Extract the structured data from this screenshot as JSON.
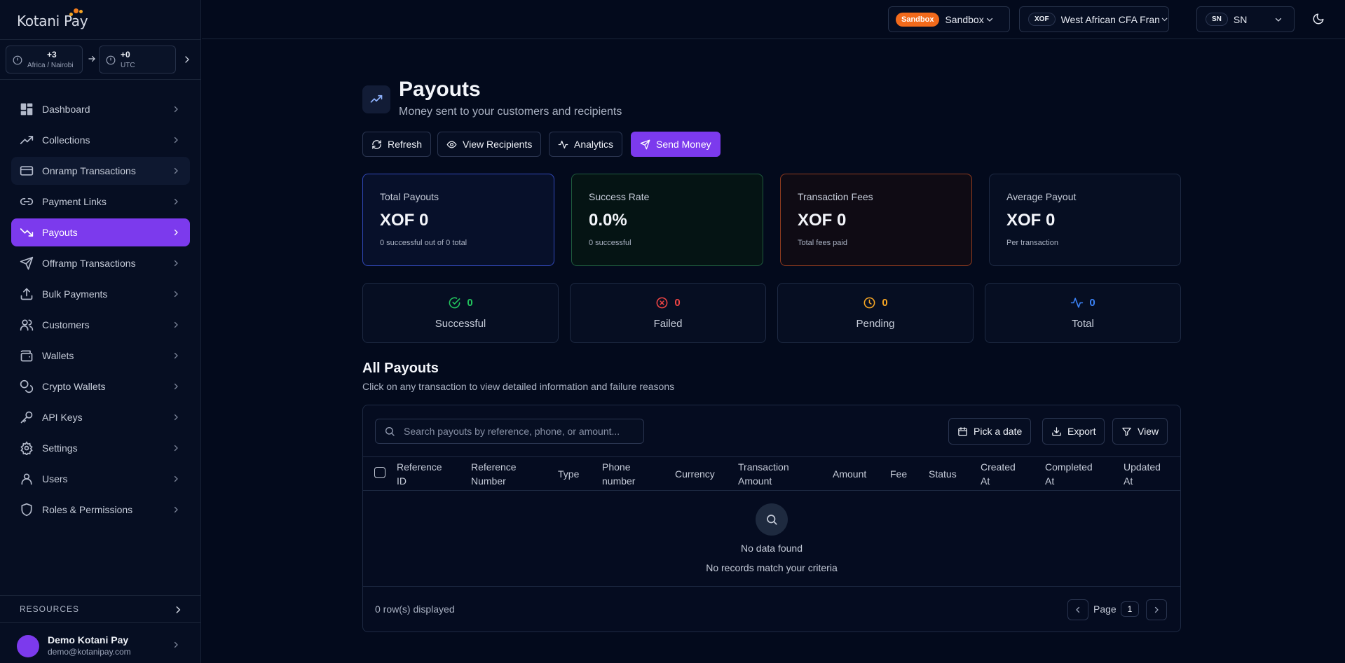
{
  "app": {
    "logo_text": "Kotani Pay"
  },
  "timezones": {
    "from": {
      "offset": "+3",
      "zone": "Africa / Nairobi"
    },
    "to": {
      "offset": "+0",
      "zone": "UTC"
    }
  },
  "topbar": {
    "environment_badge": "Sandbox",
    "environment_label": "Sandbox",
    "currency_code": "XOF",
    "currency_label": "West African CFA Franc",
    "country_code": "SN",
    "country_label": "SN"
  },
  "sidebar": {
    "items": [
      {
        "label": "Dashboard",
        "icon": "dashboard-icon"
      },
      {
        "label": "Collections",
        "icon": "trending-up-icon"
      },
      {
        "label": "Onramp Transactions",
        "icon": "credit-card-icon"
      },
      {
        "label": "Payment Links",
        "icon": "link-icon"
      },
      {
        "label": "Payouts",
        "icon": "trending-down-icon"
      },
      {
        "label": "Offramp Transactions",
        "icon": "send-icon"
      },
      {
        "label": "Bulk Payments",
        "icon": "upload-icon"
      },
      {
        "label": "Customers",
        "icon": "users-icon"
      },
      {
        "label": "Wallets",
        "icon": "wallet-icon"
      },
      {
        "label": "Crypto Wallets",
        "icon": "coins-icon"
      },
      {
        "label": "API Keys",
        "icon": "key-icon"
      },
      {
        "label": "Settings",
        "icon": "gear-icon"
      },
      {
        "label": "Users",
        "icon": "user-icon"
      },
      {
        "label": "Roles & Permissions",
        "icon": "shield-icon"
      }
    ],
    "active": "Payouts",
    "resources_label": "RESOURCES",
    "user": {
      "name": "Demo Kotani Pay",
      "email": "demo@kotanipay.com"
    }
  },
  "page": {
    "title": "Payouts",
    "subtitle": "Money sent to your customers and recipients",
    "actions": {
      "refresh": "Refresh",
      "view_recipients": "View Recipients",
      "analytics": "Analytics",
      "send_money": "Send Money"
    }
  },
  "stats": [
    {
      "label": "Total Payouts",
      "value": "XOF 0",
      "note": "0 successful out of 0 total",
      "accent": "#3148b8"
    },
    {
      "label": "Success Rate",
      "value": "0.0%",
      "note": "0 successful",
      "accent": "#1f5b3e"
    },
    {
      "label": "Transaction Fees",
      "value": "XOF 0",
      "note": "Total fees paid",
      "accent": "#8f3b1f"
    },
    {
      "label": "Average Payout",
      "value": "XOF 0",
      "note": "Per transaction",
      "accent": "#1e2a43"
    }
  ],
  "counts": [
    {
      "label": "Successful",
      "value": "0",
      "color": "#22c55e",
      "icon": "check-circle-icon"
    },
    {
      "label": "Failed",
      "value": "0",
      "color": "#ef4444",
      "icon": "x-circle-icon"
    },
    {
      "label": "Pending",
      "value": "0",
      "color": "#f5a524",
      "icon": "clock-icon"
    },
    {
      "label": "Total",
      "value": "0",
      "color": "#3b82f6",
      "icon": "activity-icon"
    }
  ],
  "table": {
    "title": "All Payouts",
    "subtitle": "Click on any transaction to view detailed information and failure reasons",
    "search_placeholder": "Search payouts by reference, phone, or amount...",
    "pick_date": "Pick a date",
    "export": "Export",
    "view": "View",
    "columns": [
      [
        "Reference",
        "ID"
      ],
      [
        "Reference",
        "Number"
      ],
      [
        "Type"
      ],
      [
        "Phone",
        "number"
      ],
      [
        "Currency"
      ],
      [
        "Transaction",
        "Amount"
      ],
      [
        "Amount"
      ],
      [
        "Fee"
      ],
      [
        "Status"
      ],
      [
        "Created",
        "At"
      ],
      [
        "Completed",
        "At"
      ],
      [
        "Updated",
        "At"
      ]
    ],
    "rows": [],
    "empty_title": "No data found",
    "empty_subtitle": "No records match your criteria",
    "rows_displayed": "0 row(s) displayed",
    "page_label": "Page",
    "page_number": "1"
  }
}
